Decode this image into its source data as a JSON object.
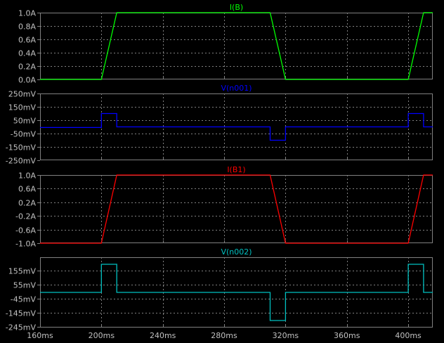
{
  "chart_data": [
    {
      "type": "line",
      "title": "I(B)",
      "color": "#00ff00",
      "ylim": [
        0,
        1.0
      ],
      "yticks": [
        {
          "v": 1.0,
          "label": "1.0A"
        },
        {
          "v": 0.8,
          "label": "0.8A"
        },
        {
          "v": 0.6,
          "label": "0.6A"
        },
        {
          "v": 0.4,
          "label": "0.4A"
        },
        {
          "v": 0.2,
          "label": "0.2A"
        },
        {
          "v": 0.0,
          "label": "0.0A"
        }
      ],
      "x": [
        160,
        200,
        210,
        310,
        320,
        400,
        410,
        416
      ],
      "y": [
        0,
        0,
        1,
        1,
        0,
        0,
        1,
        1
      ]
    },
    {
      "type": "line",
      "title": "V(n001)",
      "color": "#0000ff",
      "ylim": [
        -250,
        250
      ],
      "yticks": [
        {
          "v": 250,
          "label": "250mV"
        },
        {
          "v": 150,
          "label": "150mV"
        },
        {
          "v": 50,
          "label": "50mV"
        },
        {
          "v": -50,
          "label": "-50mV"
        },
        {
          "v": -150,
          "label": "-150mV"
        },
        {
          "v": -250,
          "label": "-250mV"
        }
      ],
      "x": [
        160,
        200,
        200,
        210,
        210,
        310,
        310,
        320,
        320,
        400,
        400,
        410,
        410,
        416
      ],
      "y": [
        -5,
        -5,
        100,
        100,
        0,
        0,
        -100,
        -100,
        0,
        0,
        100,
        100,
        0,
        0
      ]
    },
    {
      "type": "line",
      "title": "I(B1)",
      "color": "#ff0000",
      "ylim": [
        -1.0,
        1.0
      ],
      "yticks": [
        {
          "v": 1.0,
          "label": "1.0A"
        },
        {
          "v": 0.6,
          "label": "0.6A"
        },
        {
          "v": 0.2,
          "label": "0.2A"
        },
        {
          "v": -0.2,
          "label": "-0.2A"
        },
        {
          "v": -0.6,
          "label": "-0.6A"
        },
        {
          "v": -1.0,
          "label": "-1.0A"
        }
      ],
      "x": [
        160,
        200,
        210,
        310,
        320,
        400,
        410,
        416
      ],
      "y": [
        -1,
        -1,
        1,
        1,
        -1,
        -1,
        1,
        1
      ]
    },
    {
      "type": "line",
      "title": "V(n002)",
      "color": "#00c0c0",
      "ylim": [
        -250,
        250
      ],
      "yticks": [
        {
          "v": 155,
          "label": "155mV"
        },
        {
          "v": 55,
          "label": "55mV"
        },
        {
          "v": -45,
          "label": "-45mV"
        },
        {
          "v": -145,
          "label": "-145mV"
        },
        {
          "v": -245,
          "label": "-245mV"
        }
      ],
      "x": [
        160,
        200,
        200,
        210,
        210,
        310,
        310,
        320,
        320,
        400,
        400,
        410,
        410,
        416
      ],
      "y": [
        0,
        0,
        200,
        200,
        0,
        0,
        -200,
        -200,
        0,
        0,
        200,
        200,
        0,
        0
      ]
    }
  ],
  "x_axis": {
    "range": [
      160,
      416
    ],
    "ticks": [
      {
        "v": 160,
        "label": "160ms"
      },
      {
        "v": 200,
        "label": "200ms"
      },
      {
        "v": 240,
        "label": "240ms"
      },
      {
        "v": 280,
        "label": "280ms"
      },
      {
        "v": 320,
        "label": "320ms"
      },
      {
        "v": 360,
        "label": "360ms"
      },
      {
        "v": 400,
        "label": "400ms"
      }
    ]
  },
  "colors": {
    "background": "#000000",
    "frame": "#808080",
    "grid": "#808080",
    "text": "#c0c0c0"
  }
}
